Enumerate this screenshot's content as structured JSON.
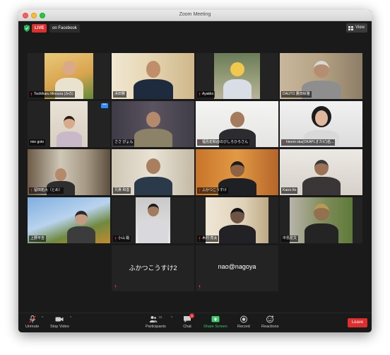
{
  "window": {
    "title": "Zoom Meeting"
  },
  "topbar": {
    "live_label": "LIVE",
    "live_destination": "on Facebook",
    "view_label": "View"
  },
  "tiles": [
    {
      "name": "Toshiharu Minoura (みの)",
      "muted": true
    },
    {
      "name": "浜田賢",
      "muted": false
    },
    {
      "name": "Ayakko",
      "muted": true
    },
    {
      "name": "DAUTO 鷹田秋雅",
      "muted": false
    },
    {
      "name": "mie goto",
      "muted": false
    },
    {
      "name": "ささ ぴょん",
      "muted": false
    },
    {
      "name": "福島宏和@のびしろひろさん",
      "muted": true
    },
    {
      "name": "hiromi oka(OKAPI.オカピ)名...",
      "muted": true
    },
    {
      "name": "留田拓大（とめ）",
      "muted": true
    },
    {
      "name": "兄貴 和善",
      "muted": false
    },
    {
      "name": "ふかつこうすけ",
      "muted": true
    },
    {
      "name": "Kaizo Ito",
      "muted": false
    },
    {
      "name": "上野平吉",
      "muted": false
    },
    {
      "name": "小山 聡",
      "muted": true
    },
    {
      "name": "木村 亮太",
      "muted": true
    },
    {
      "name": "中島宏文",
      "muted": false
    },
    {
      "name": "ふかつこうすけ2",
      "muted": true,
      "video_off": true
    },
    {
      "name": "nao@nagoya",
      "muted": true,
      "video_off": true
    }
  ],
  "toolbar": {
    "unmute_label": "Unmute",
    "stop_video_label": "Stop Video",
    "participants_label": "Participants",
    "participants_count": "18",
    "chat_label": "Chat",
    "chat_badge": "4",
    "share_screen_label": "Share Screen",
    "record_label": "Record",
    "reactions_label": "Reactions",
    "leave_label": "Leave"
  },
  "colors": {
    "active_speaker": "#f5df3a",
    "share_green": "#3ccc6a",
    "leave_red": "#e02d2d",
    "live_red": "#e02d2d",
    "accent_blue": "#2d8cff"
  }
}
